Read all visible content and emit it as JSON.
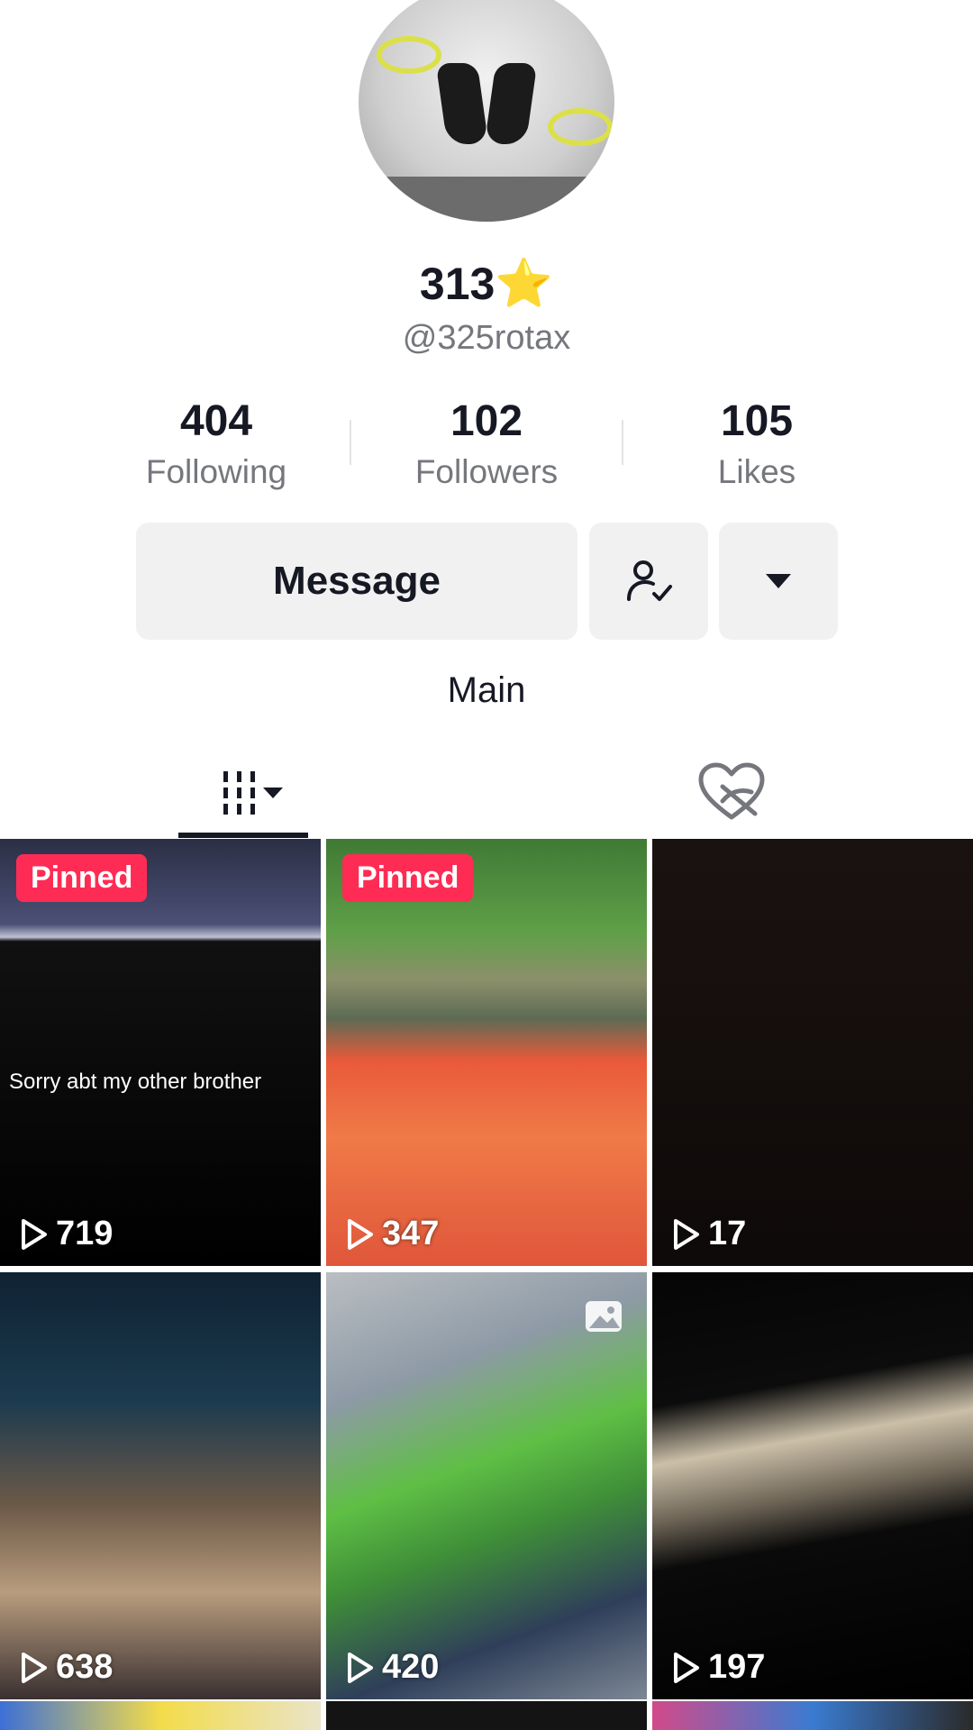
{
  "profile": {
    "display_name": "313",
    "name_emoji": "⭐",
    "username": "@325rotax"
  },
  "stats": [
    {
      "value": "404",
      "label": "Following"
    },
    {
      "value": "102",
      "label": "Followers"
    },
    {
      "value": "105",
      "label": "Likes"
    }
  ],
  "actions": {
    "message_label": "Message",
    "follow_status_icon": "person-check-icon",
    "more_icon": "caret-down-icon"
  },
  "playlist_label": "Main",
  "tabs": [
    {
      "name": "videos",
      "icon": "grid-icon"
    },
    {
      "name": "liked",
      "icon": "hidden-heart-icon"
    }
  ],
  "videos": [
    {
      "views": "719",
      "pinned": "Pinned",
      "caption": "Sorry abt my other brother"
    },
    {
      "views": "347",
      "pinned": "Pinned"
    },
    {
      "views": "17"
    },
    {
      "views": "638"
    },
    {
      "views": "420"
    },
    {
      "views": "197"
    }
  ],
  "colors": {
    "pinned_badge": "#fe2c55",
    "secondary_text": "#75777d",
    "button_bg": "#f1f1f2"
  }
}
